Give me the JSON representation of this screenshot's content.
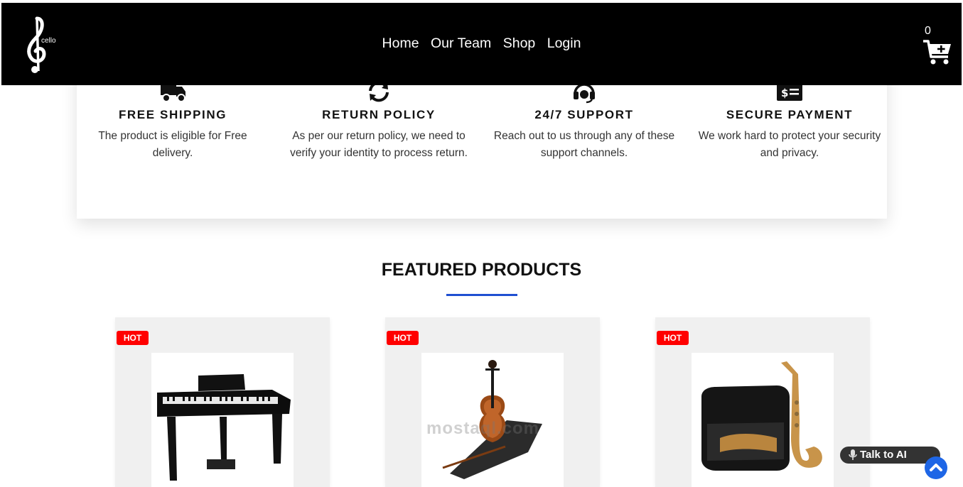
{
  "header": {
    "logo_text": "cello",
    "nav": [
      "Home",
      "Our Team",
      "Shop",
      "Login"
    ],
    "cart_count": "0"
  },
  "features": [
    {
      "icon": "truck-icon",
      "title": "FREE SHIPPING",
      "line1": "The product is eligible for Free",
      "line2": "delivery."
    },
    {
      "icon": "refresh-icon",
      "title": "RETURN POLICY",
      "line1": "As per our return policy, we need to",
      "line2": "verify your identity to process return."
    },
    {
      "icon": "headset-icon",
      "title": "24/7 SUPPORT",
      "line1": "Reach out to us through any of these",
      "line2": "support channels."
    },
    {
      "icon": "payment-icon",
      "title": "SECURE PAYMENT",
      "line1": "We work hard to protect your security",
      "line2": "and privacy."
    }
  ],
  "featured": {
    "title": "FEATURED PRODUCTS",
    "accent_color": "#1f4fd1",
    "products": [
      {
        "badge": "HOT",
        "image": "piano"
      },
      {
        "badge": "HOT",
        "image": "violin"
      },
      {
        "badge": "HOT",
        "image": "saxophone"
      }
    ]
  },
  "widgets": {
    "talk_ai": "Talk to AI",
    "watermark": "mostaql.com"
  },
  "colors": {
    "header_bg": "#000000",
    "badge": "#ff0000",
    "scroll_top": "#1e66e6"
  }
}
